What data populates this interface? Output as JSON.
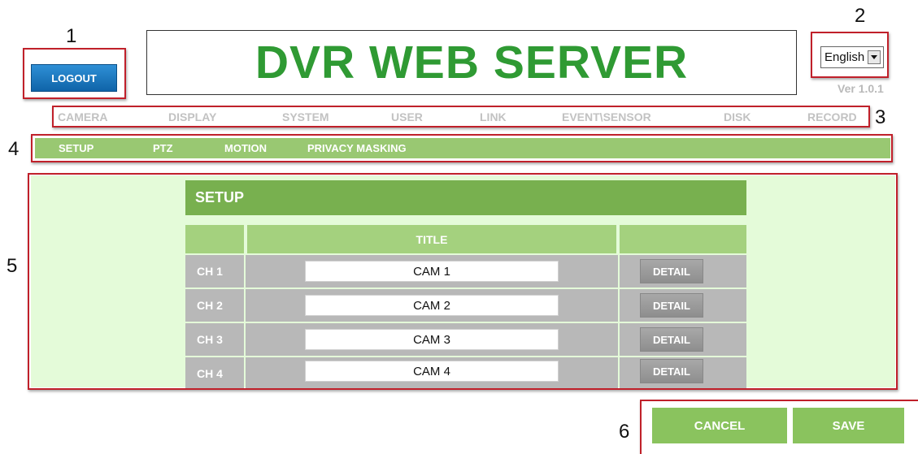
{
  "callouts": [
    "1",
    "2",
    "3",
    "4",
    "5",
    "6"
  ],
  "header": {
    "logout_label": "LOGOUT",
    "title": "DVR WEB SERVER",
    "language": "English",
    "version": "Ver 1.0.1"
  },
  "topnav": [
    "CAMERA",
    "DISPLAY",
    "SYSTEM",
    "USER",
    "LINK",
    "EVENT\\SENSOR",
    "DISK",
    "RECORD"
  ],
  "subnav": [
    "SETUP",
    "PTZ",
    "MOTION",
    "PRIVACY MASKING"
  ],
  "panel": {
    "title": "SETUP",
    "column_title": "TITLE",
    "rows": [
      {
        "channel": "CH 1",
        "title": "CAM 1",
        "detail": "DETAIL"
      },
      {
        "channel": "CH 2",
        "title": "CAM 2",
        "detail": "DETAIL"
      },
      {
        "channel": "CH 3",
        "title": "CAM 3",
        "detail": "DETAIL"
      },
      {
        "channel": "CH 4",
        "title": "CAM 4",
        "detail": "DETAIL"
      }
    ]
  },
  "actions": {
    "cancel": "CANCEL",
    "save": "SAVE"
  },
  "colors": {
    "title_green": "#2f9a33",
    "accent_green": "#78b04f",
    "callout_red": "#c0202a",
    "logout_blue": "#1b77c0"
  }
}
